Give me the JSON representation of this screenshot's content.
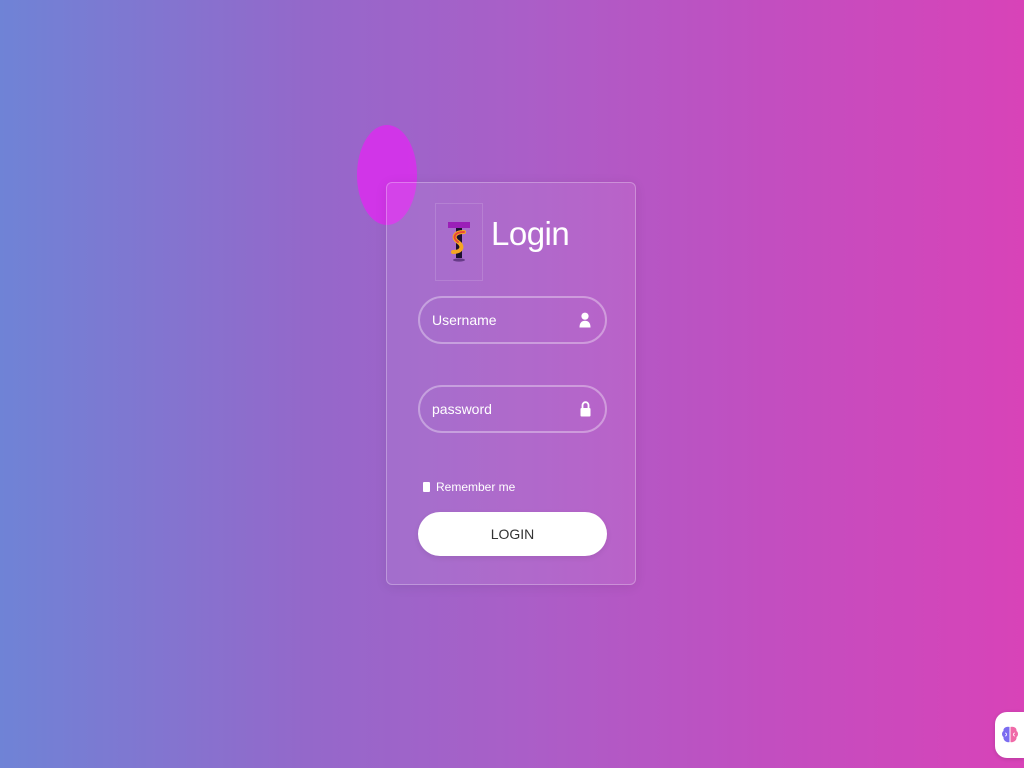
{
  "login_card": {
    "title": "Login",
    "logo_icon": "brand-t-s-logo-icon",
    "username": {
      "value": "",
      "placeholder": "Username",
      "icon": "user-icon"
    },
    "password": {
      "value": "",
      "placeholder": "password",
      "icon": "lock-icon"
    },
    "remember_label": "Remember me",
    "login_button_label": "LOGIN"
  },
  "extension_widget": {
    "icon": "brain-icon"
  },
  "colors": {
    "gradient_start": "#6f83d6",
    "gradient_end": "#d843b8",
    "blob": "#d631ea",
    "logo_purple": "#9b1fb8",
    "logo_orange": "#f5a623",
    "button_bg": "#ffffff",
    "button_text": "#333333"
  }
}
